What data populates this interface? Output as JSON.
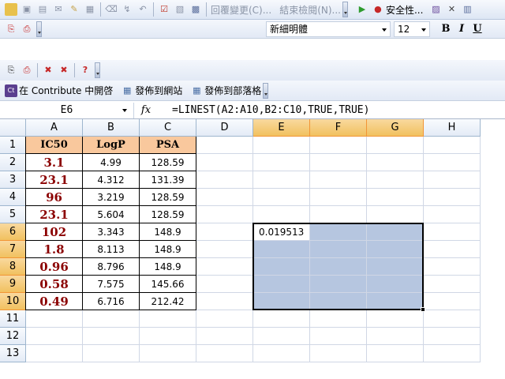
{
  "toolbar_review": {
    "reply_label": "回覆變更(C)...",
    "end_review_label": "結束檢閱(N)...",
    "security_label": "安全性..."
  },
  "toolbar_format": {
    "font_name": "新細明體",
    "font_size": "12",
    "bold": "B",
    "italic": "I",
    "underline": "U"
  },
  "toolbar_contribute": {
    "open_label": "在 Contribute 中開啓",
    "publish_site_label": "發佈到網站",
    "publish_blog_label": "發佈到部落格",
    "ct_badge": "Ct"
  },
  "formula_bar": {
    "name_box": "E6",
    "fx": "fx",
    "formula": "=LINEST(A2:A10,B2:C10,TRUE,TRUE)"
  },
  "columns": [
    "A",
    "B",
    "C",
    "D",
    "E",
    "F",
    "G",
    "H"
  ],
  "rows": [
    "1",
    "2",
    "3",
    "4",
    "5",
    "6",
    "7",
    "8",
    "9",
    "10",
    "11",
    "12",
    "13"
  ],
  "headers": [
    "IC50",
    "LogP",
    "PSA"
  ],
  "table": [
    [
      "3.1",
      "4.99",
      "128.59"
    ],
    [
      "23.1",
      "4.312",
      "131.39"
    ],
    [
      "96",
      "3.219",
      "128.59"
    ],
    [
      "23.1",
      "5.604",
      "128.59"
    ],
    [
      "102",
      "3.343",
      "148.9"
    ],
    [
      "1.8",
      "8.113",
      "148.9"
    ],
    [
      "0.96",
      "8.796",
      "148.9"
    ],
    [
      "0.58",
      "7.575",
      "145.66"
    ],
    [
      "0.49",
      "6.716",
      "212.42"
    ]
  ],
  "active_cell_value": "0.019513",
  "colors": {
    "header_fill": "#f9c89d",
    "ic50_text": "#8b0000",
    "selection_fill": "#b6c6e0",
    "selected_header": "#f1c15f"
  }
}
